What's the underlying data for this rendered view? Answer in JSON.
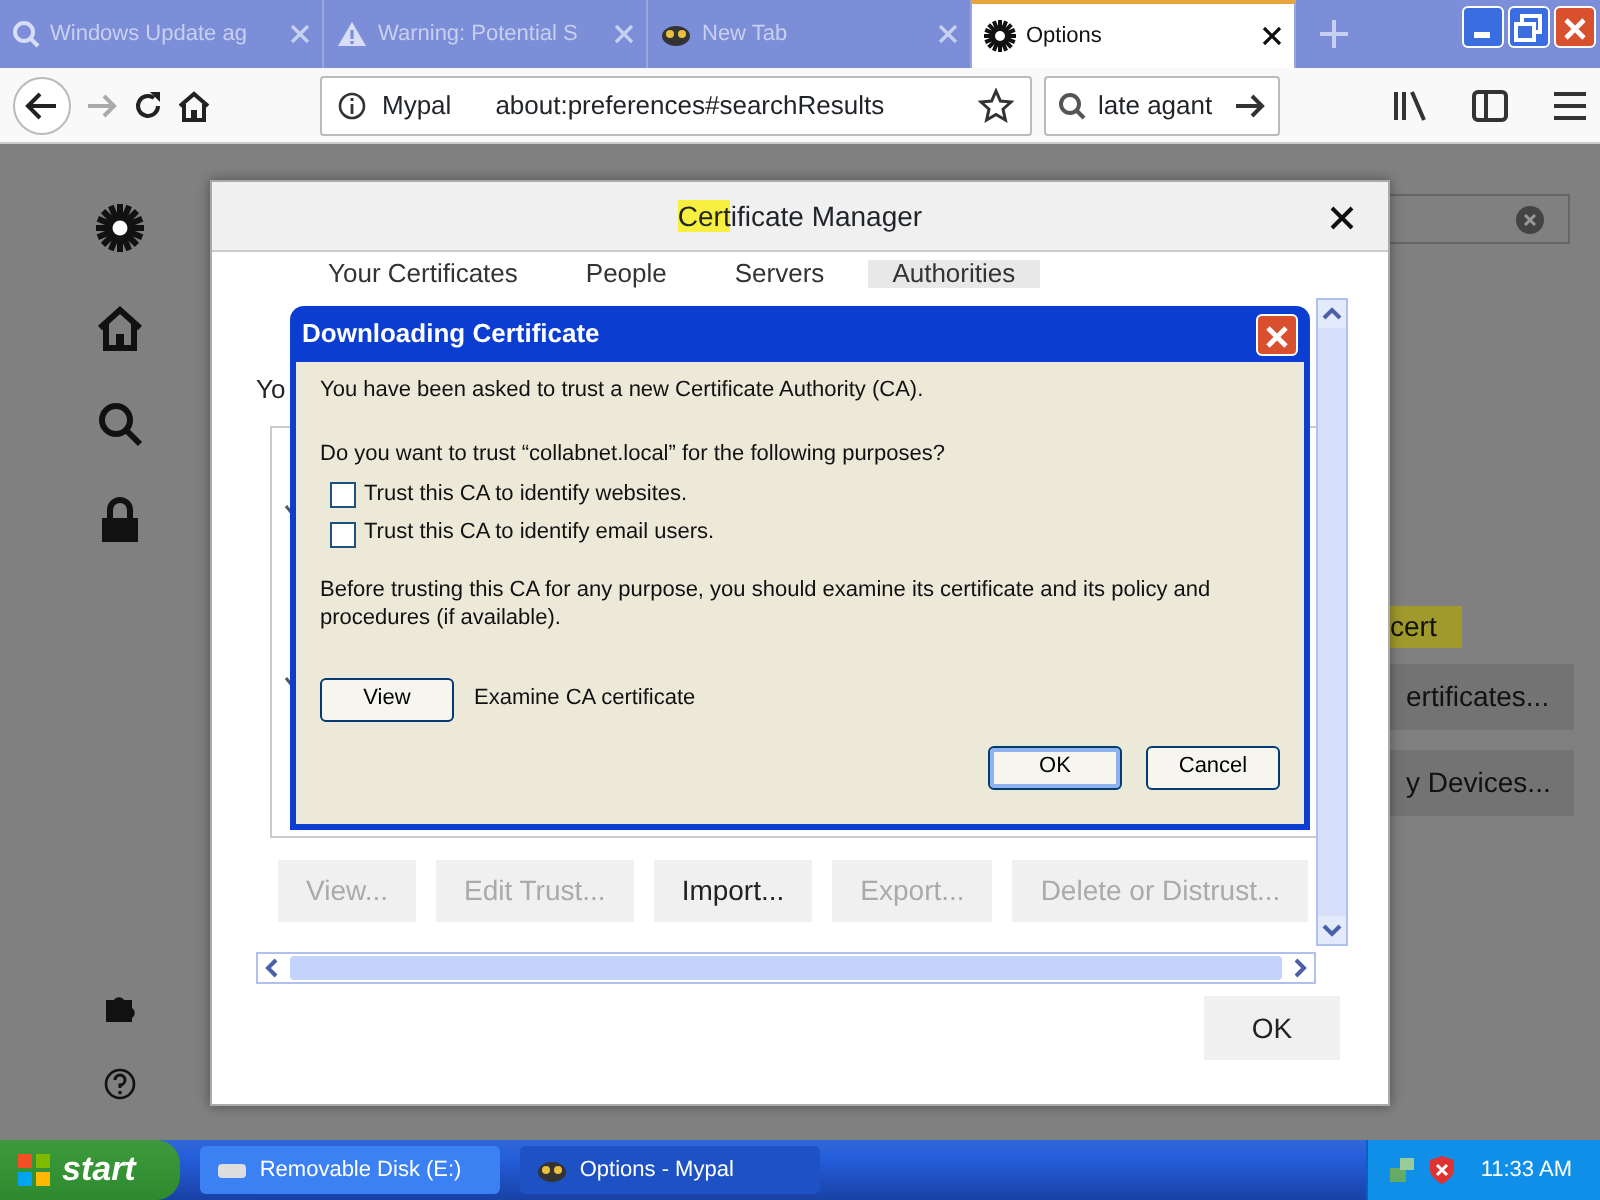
{
  "browser_tabs": [
    {
      "label": "Windows Update ag",
      "kind": "search",
      "selected": false
    },
    {
      "label": "Warning: Potential S",
      "kind": "warning",
      "selected": false
    },
    {
      "label": "New Tab",
      "kind": "mascot",
      "selected": false
    },
    {
      "label": "Options",
      "kind": "gear",
      "selected": true
    }
  ],
  "toolbar": {
    "identity": "Mypal",
    "url": "about:preferences#searchResults",
    "search_value": "late agant"
  },
  "page": {
    "cert_label": "cert",
    "buttons": [
      "ertificates...",
      "y Devices..."
    ]
  },
  "certificate_manager": {
    "title_highlight": "Cert",
    "title_rest": "ificate Manager",
    "tabs": [
      {
        "label": "Your Certificates",
        "selected": false
      },
      {
        "label": "People",
        "selected": false
      },
      {
        "label": "Servers",
        "selected": false
      },
      {
        "label": "Authorities",
        "selected": true
      }
    ],
    "intro": "Yo",
    "buttons": [
      {
        "label": "View...",
        "disabled": true
      },
      {
        "label": "Edit Trust...",
        "disabled": true
      },
      {
        "label": "Import...",
        "disabled": false
      },
      {
        "label": "Export...",
        "disabled": true
      },
      {
        "label": "Delete or Distrust...",
        "disabled": true
      }
    ],
    "ok": "OK"
  },
  "download_dialog": {
    "title": "Downloading Certificate",
    "message": "You have been asked to trust a new Certificate Authority (CA).",
    "question": "Do you want to trust “collabnet.local” for the following purposes?",
    "options": [
      {
        "label": "Trust this CA to identify websites.",
        "checked": false
      },
      {
        "label": "Trust this CA to identify email users.",
        "checked": false
      }
    ],
    "note": "Before trusting this CA for any purpose, you should examine its certificate and its policy and procedures (if available).",
    "view_button": "View",
    "view_label": "Examine CA certificate",
    "ok": "OK",
    "cancel": "Cancel"
  },
  "taskbar": {
    "start": "start",
    "tasks": [
      {
        "label": "Removable Disk (E:)",
        "selected": false
      },
      {
        "label": "Options - Mypal",
        "selected": true
      }
    ],
    "clock": "11:33 AM"
  }
}
